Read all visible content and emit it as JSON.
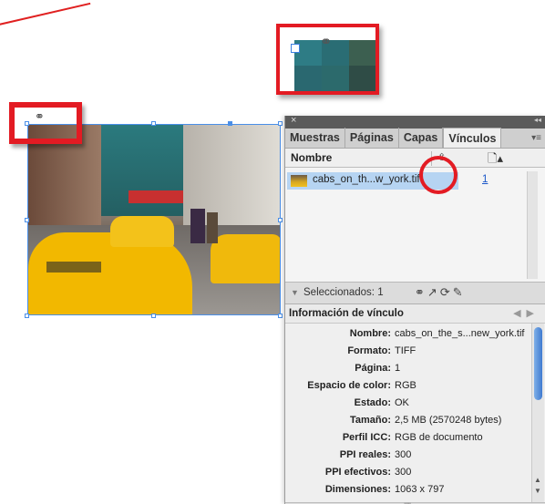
{
  "colors": {
    "annotation": "#e31b23",
    "selection_blue": "#4a8fe8",
    "panel_bg": "#e7e7e7",
    "row_selected": "#b6d4f2",
    "link_blue": "#1a56c8"
  },
  "panel": {
    "close_glyph": "×",
    "collapse_glyph": "◂◂",
    "tabs": [
      {
        "label": "Muestras",
        "active": false
      },
      {
        "label": "Páginas",
        "active": false
      },
      {
        "label": "Capas",
        "active": false
      },
      {
        "label": "Vínculos",
        "active": true
      }
    ],
    "menu_glyph": "▾≡",
    "columns": {
      "name": "Nombre",
      "sort_icon": "⇧",
      "page_icon": "🗋▴"
    },
    "links": [
      {
        "name": "cabs_on_th...w_york.tif",
        "page": "1",
        "selected": true
      }
    ],
    "status": {
      "selected_text": "Seleccionados: 1",
      "icons": [
        "relink-icon",
        "goto-link-icon",
        "update-link-icon",
        "edit-original-icon"
      ]
    },
    "info": {
      "title": "Información de vínculo",
      "rows": [
        {
          "label": "Nombre:",
          "value": "cabs_on_the_s...new_york.tif"
        },
        {
          "label": "Formato:",
          "value": "TIFF"
        },
        {
          "label": "Página:",
          "value": "1"
        },
        {
          "label": "Espacio de color:",
          "value": "RGB"
        },
        {
          "label": "Estado:",
          "value": "OK"
        },
        {
          "label": "Tamaño:",
          "value": "2,5 MB (2570248 bytes)"
        },
        {
          "label": "Perfil ICC:",
          "value": "RGB de documento"
        },
        {
          "label": "PPI reales:",
          "value": "300"
        },
        {
          "label": "PPI efectivos:",
          "value": "300"
        },
        {
          "label": "Dimensiones:",
          "value": "1063 x 797"
        }
      ]
    }
  }
}
